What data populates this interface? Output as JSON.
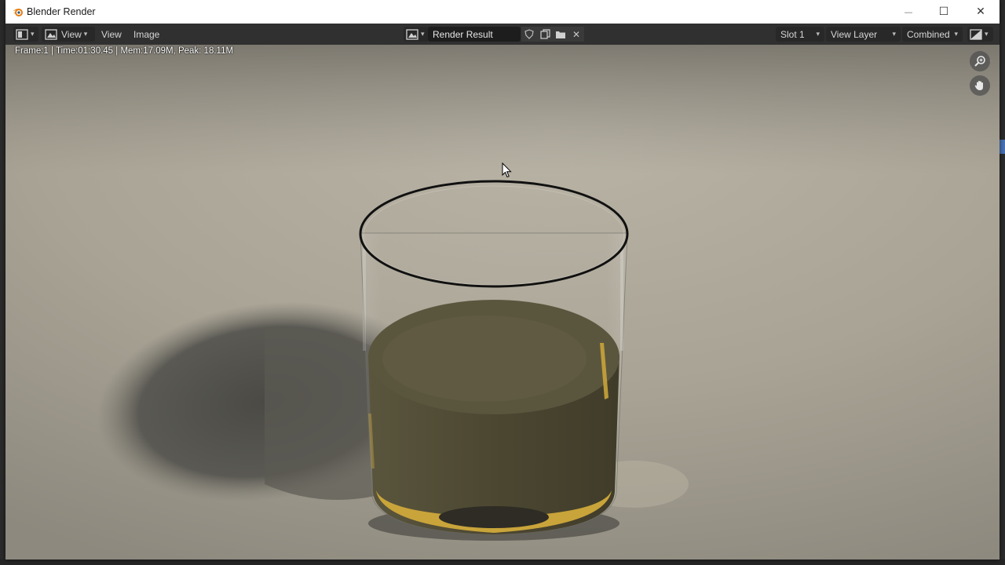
{
  "window": {
    "title": "Blender Render",
    "controls": {
      "minimize": "—",
      "maximize": "☐",
      "close": "✕"
    }
  },
  "header": {
    "editor_type_icon": "image-editor-icon",
    "view_mode_label": "View",
    "menus": [
      "View",
      "Image"
    ],
    "image_name": "Render Result",
    "slot": "Slot 1",
    "view_layer": "View Layer",
    "pass": "Combined"
  },
  "viewport": {
    "info": "Frame:1 | Time:01:30.45 | Mem:17.09M, Peak: 18.11M",
    "colors": {
      "floor": "#a8a293",
      "shadow": "#56554f",
      "liquid": "#4f4a33",
      "liquid_highlight": "#c9a43a",
      "rim": "#111111"
    }
  }
}
